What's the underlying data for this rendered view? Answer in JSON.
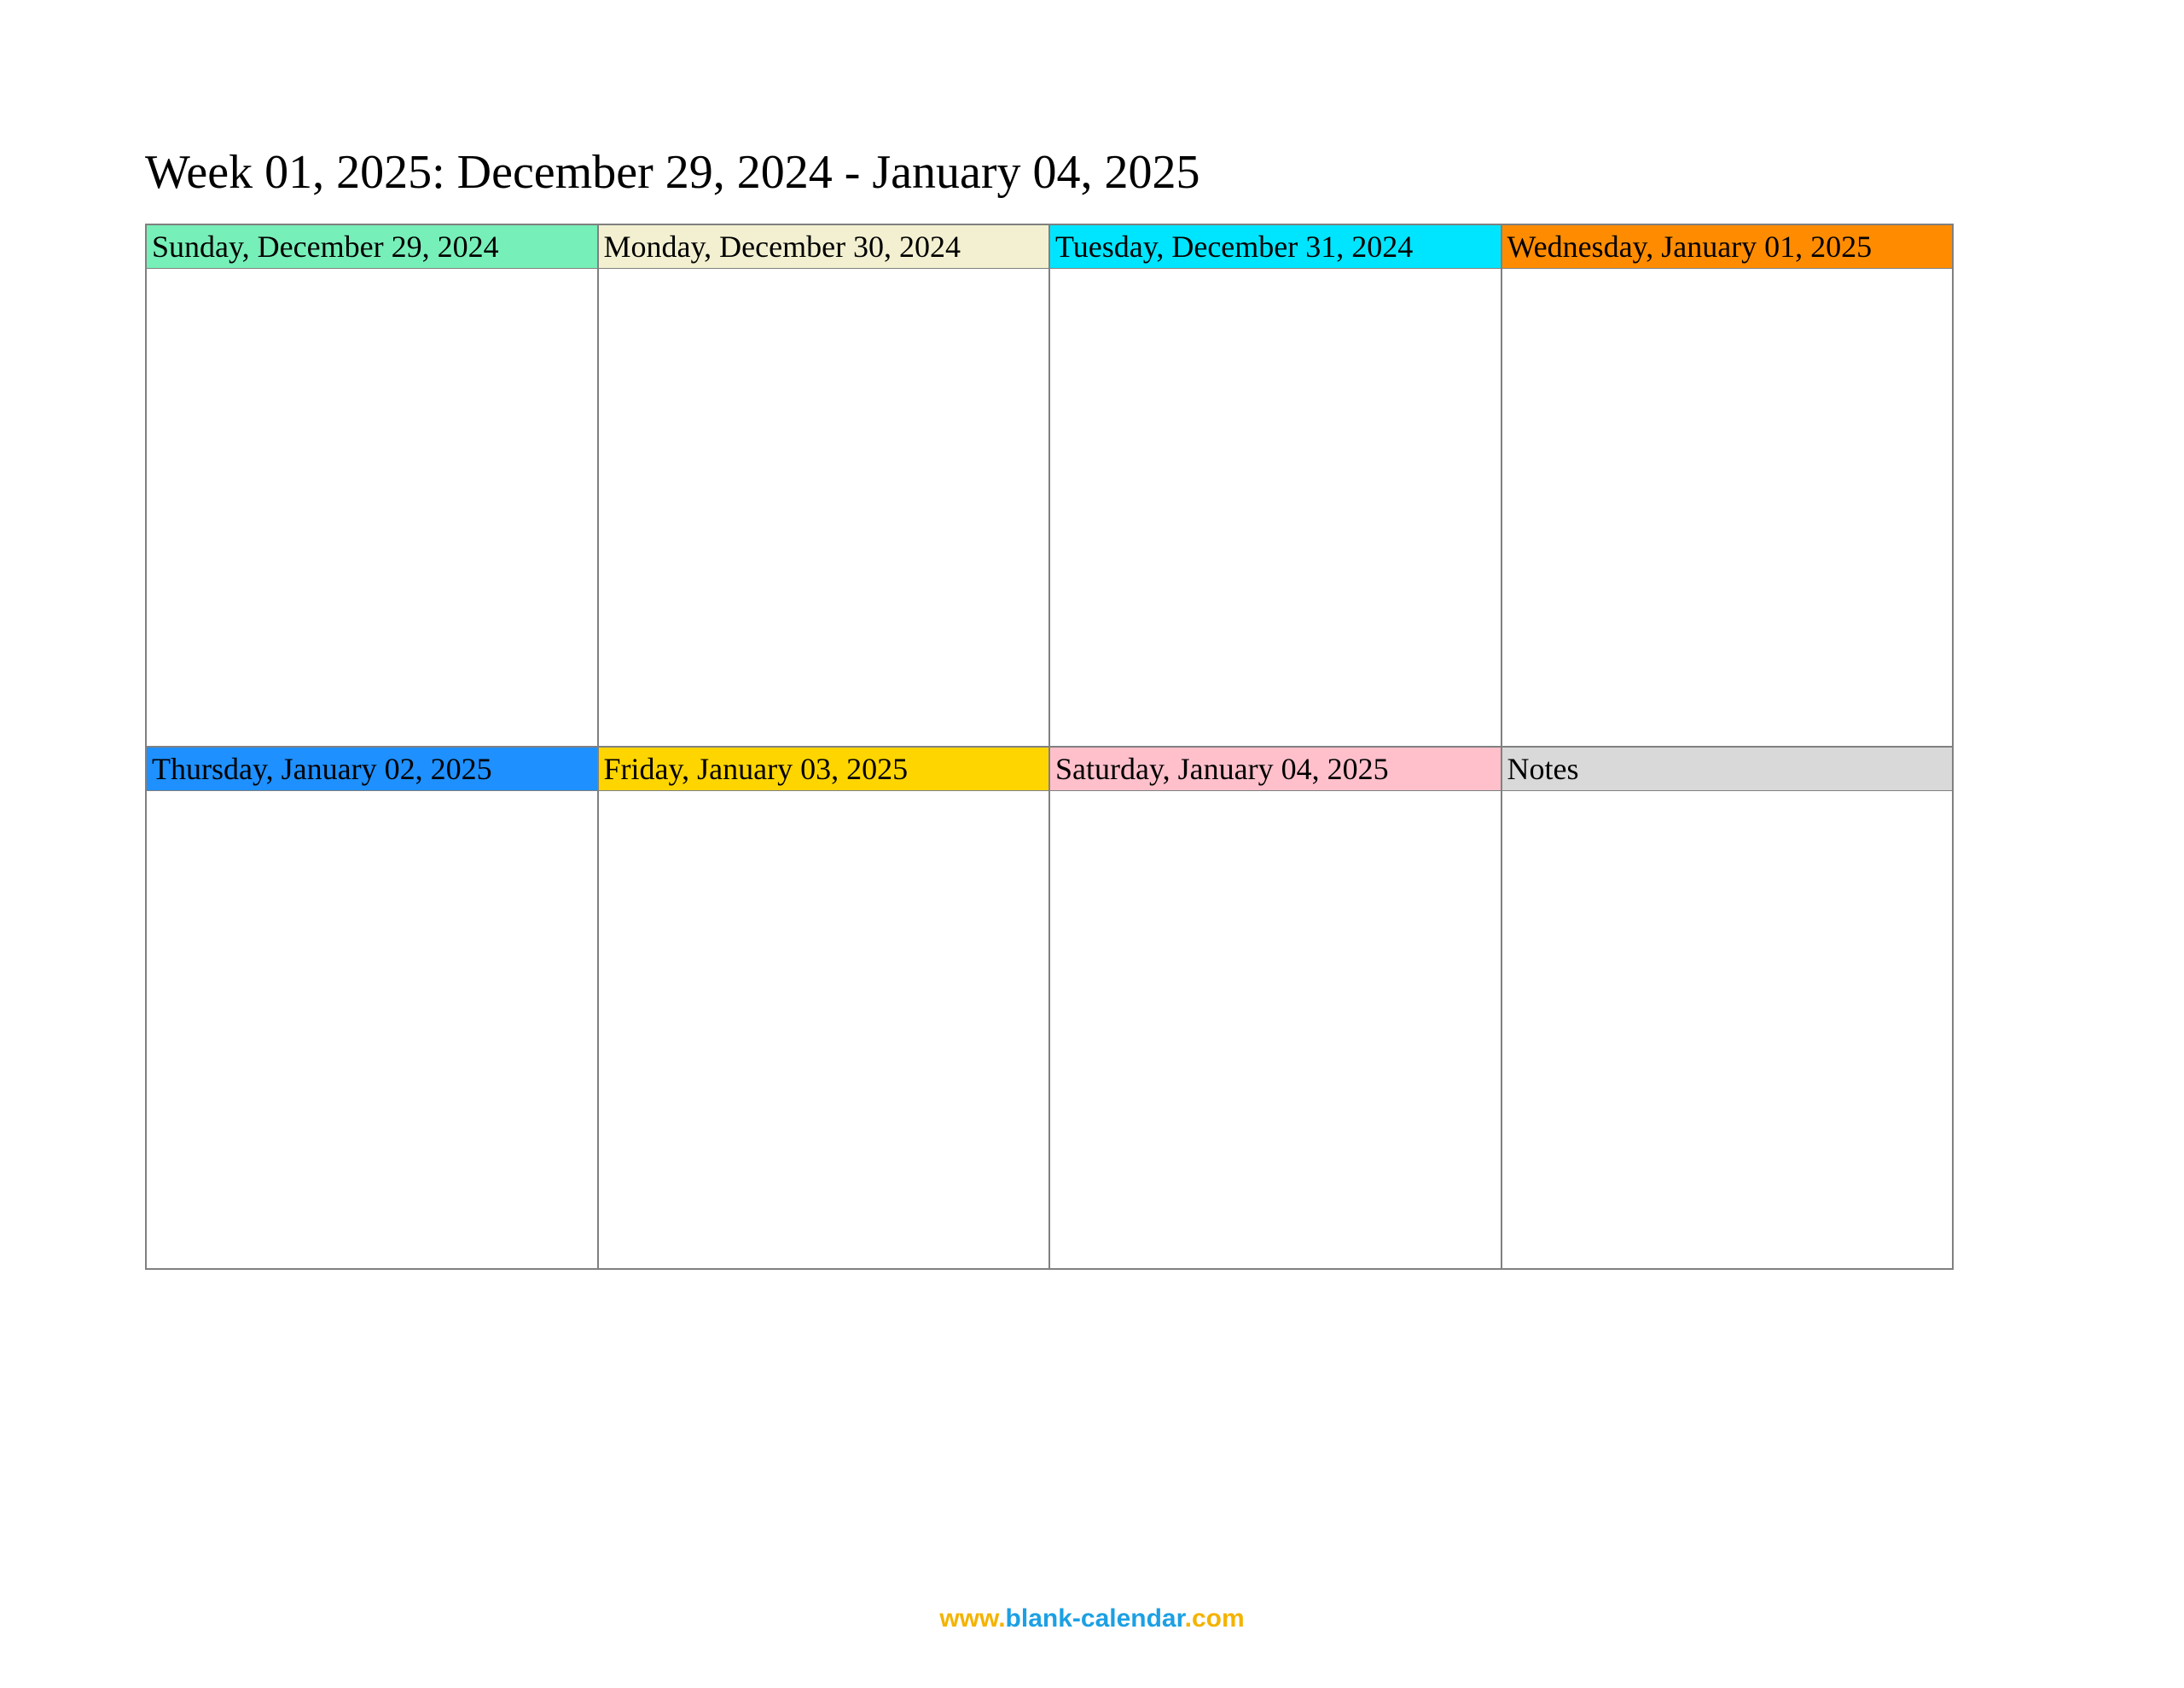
{
  "title": "Week 01, 2025: December 29, 2024 - January 04, 2025",
  "days": {
    "sunday": {
      "label": "Sunday, December 29, 2024"
    },
    "monday": {
      "label": "Monday, December 30, 2024"
    },
    "tuesday": {
      "label": "Tuesday, December 31, 2024"
    },
    "wednesday": {
      "label": "Wednesday, January 01, 2025"
    },
    "thursday": {
      "label": "Thursday, January 02, 2025"
    },
    "friday": {
      "label": "Friday, January 03, 2025"
    },
    "saturday": {
      "label": "Saturday, January 04, 2025"
    },
    "notes": {
      "label": "Notes"
    }
  },
  "footer": {
    "www": "www.",
    "domain": "blank-calendar",
    "com": ".com"
  }
}
